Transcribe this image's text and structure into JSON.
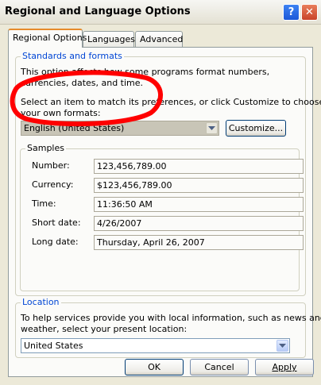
{
  "window": {
    "title": "Regional and Language Options",
    "help_glyph": "?",
    "close_glyph": "✕"
  },
  "tabs": [
    {
      "label": "Regional Options",
      "active": true
    },
    {
      "label": "Languages",
      "active": false
    },
    {
      "label": "Advanced",
      "active": false
    }
  ],
  "standards": {
    "group_title": "Standards and formats",
    "description": "This option affects how some programs format numbers, currencies, dates, and time.",
    "select_line1": "Select an item to match its preferences, or click Customize to choose",
    "select_line2": "your own formats:",
    "format_value": "English (United States)",
    "customize_label": "Customize...",
    "samples_title": "Samples",
    "samples": [
      {
        "label": "Number:",
        "value": "123,456,789.00"
      },
      {
        "label": "Currency:",
        "value": "$123,456,789.00"
      },
      {
        "label": "Time:",
        "value": "11:36:50 AM"
      },
      {
        "label": "Short date:",
        "value": "4/26/2007"
      },
      {
        "label": "Long date:",
        "value": "Thursday, April 26, 2007"
      }
    ]
  },
  "location": {
    "group_title": "Location",
    "description_line1": "To help services provide you with local information, such as news and",
    "description_line2": "weather, select your present location:",
    "value": "United States"
  },
  "buttons": {
    "ok": "OK",
    "cancel": "Cancel",
    "apply": "Apply"
  },
  "colors": {
    "group_title": "#0046d5",
    "active_tab_accent": "#e68b2c",
    "annotation": "#ff0000"
  }
}
